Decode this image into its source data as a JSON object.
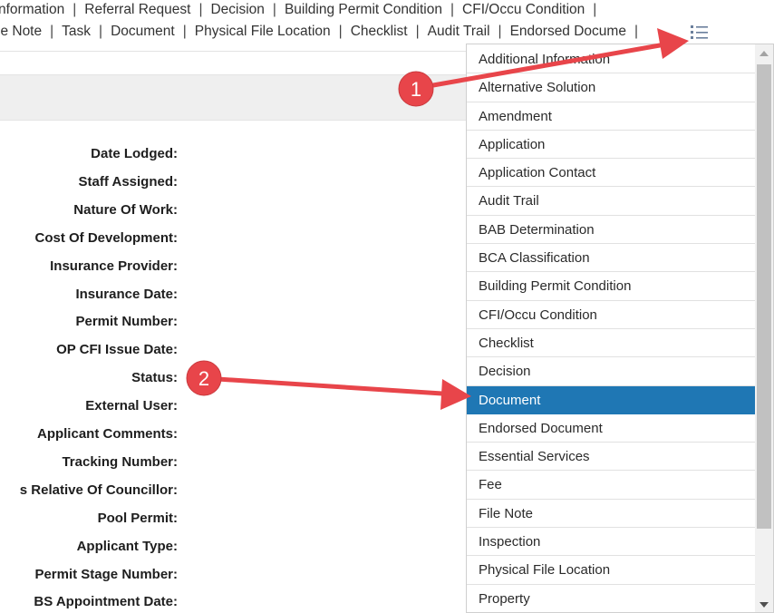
{
  "tabs": {
    "row1": [
      "nformation",
      "Referral Request",
      "Decision",
      "Building Permit Condition",
      "CFI/Occu Condition"
    ],
    "row2": [
      "le Note",
      "Task",
      "Document",
      "Physical File Location",
      "Checklist",
      "Audit Trail",
      "Endorsed Docume"
    ],
    "separator": "|",
    "more_icon": "list-menu-icon"
  },
  "form": {
    "labels": [
      "Date Lodged:",
      "Staff Assigned:",
      "Nature Of Work:",
      "Cost Of Development:",
      "Insurance Provider:",
      "Insurance Date:",
      "Permit Number:",
      "OP CFI Issue Date:",
      "Status:",
      "External User:",
      "Applicant Comments:",
      "Tracking Number:",
      "s Relative Of Councillor:",
      "Pool Permit:",
      "Applicant Type:",
      "Permit Stage Number:",
      "BS Appointment Date:"
    ]
  },
  "dropdown": {
    "items": [
      "Additional Information",
      "Alternative Solution",
      "Amendment",
      "Application",
      "Application Contact",
      "Audit Trail",
      "BAB Determination",
      "BCA Classification",
      "Building Permit Condition",
      "CFI/Occu Condition",
      "Checklist",
      "Decision",
      "Document",
      "Endorsed Document",
      "Essential Services",
      "Fee",
      "File Note",
      "Inspection",
      "Physical File Location",
      "Property"
    ],
    "selected": "Document",
    "selected_color": "#1f77b4"
  },
  "annotations": {
    "markers": [
      "1",
      "2"
    ],
    "color": "#e8454a"
  }
}
